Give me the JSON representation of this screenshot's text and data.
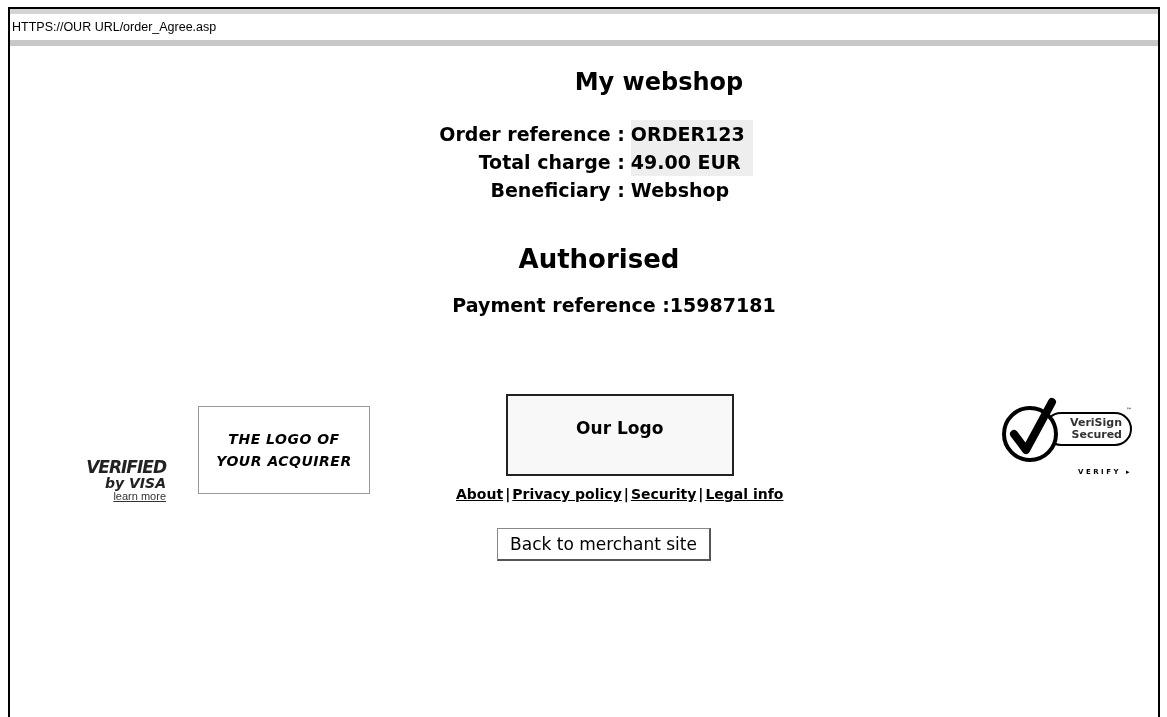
{
  "address_bar": {
    "url": "HTTPS://OUR URL/order_Agree.asp"
  },
  "title": "My webshop",
  "details": [
    {
      "label": "Order reference :",
      "value": "ORDER123",
      "highlighted": true
    },
    {
      "label": "Total charge :",
      "value": "49.00 EUR",
      "highlighted": true
    },
    {
      "label": "Beneficiary :",
      "value": "Webshop",
      "highlighted": false
    }
  ],
  "status": "Authorised",
  "payment_reference": "Payment reference :15987181",
  "visa_badge": {
    "line_1": "VERIFIED",
    "line_2": "by VISA",
    "link": "learn more"
  },
  "acquirer_logo": {
    "lines": [
      "THE LOGO OF",
      "YOUR ACQUIRER"
    ]
  },
  "merchant_logo": "Our Logo",
  "footer_links": [
    {
      "label": "About",
      "separator": "|"
    },
    {
      "label": "Privacy policy",
      "separator": "|"
    },
    {
      "label": "Security",
      "separator": "|"
    },
    {
      "label": "Legal info"
    }
  ],
  "verisign_badge": {
    "line_1": "VeriSign",
    "line_2": "Secured",
    "link": "VERIFY ▸",
    "tm": "™"
  },
  "back_button": "Back to merchant site"
}
